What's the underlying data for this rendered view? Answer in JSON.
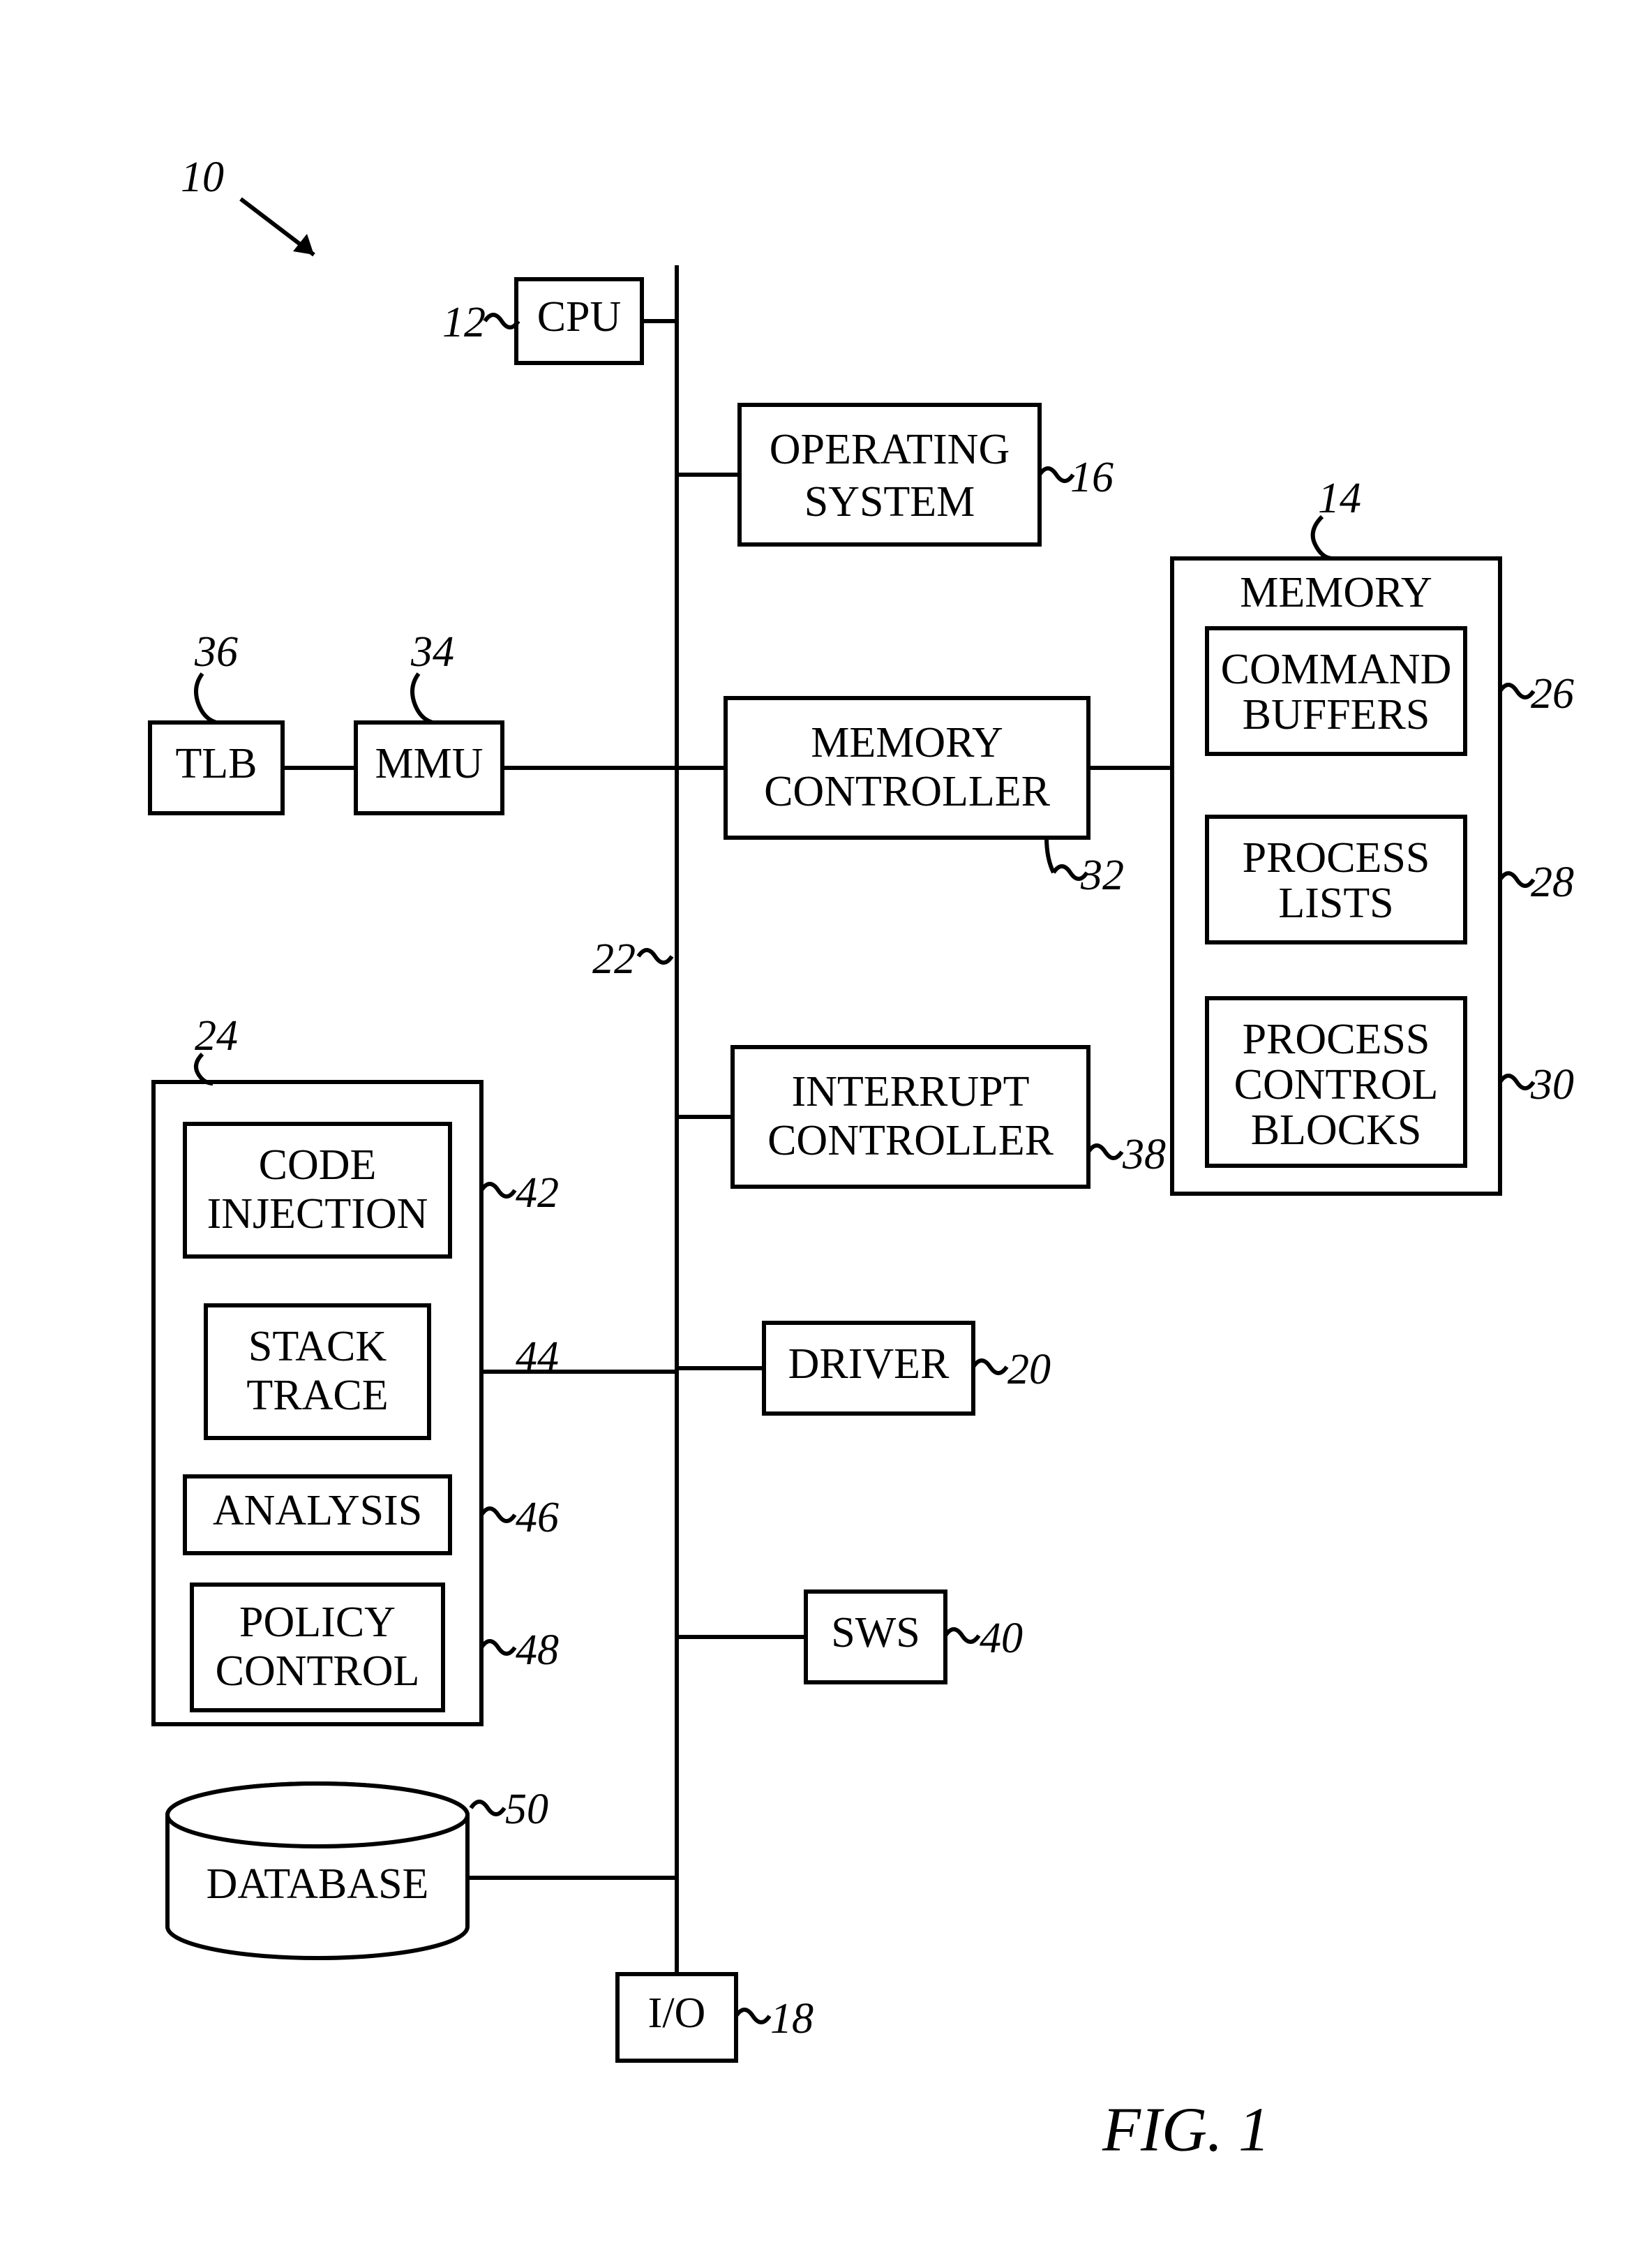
{
  "figure": {
    "caption": "FIG. 1",
    "overall_ref": "10"
  },
  "blocks": {
    "cpu": {
      "label": "CPU",
      "ref": "12"
    },
    "os": {
      "label1": "OPERATING",
      "label2": "SYSTEM",
      "ref": "16"
    },
    "mem": {
      "title": "MEMORY",
      "ref": "14"
    },
    "cmdbuf": {
      "label1": "COMMAND",
      "label2": "BUFFERS",
      "ref": "26"
    },
    "plist": {
      "label1": "PROCESS",
      "label2": "LISTS",
      "ref": "28"
    },
    "pcb": {
      "label1": "PROCESS",
      "label2": "CONTROL",
      "label3": "BLOCKS",
      "ref": "30"
    },
    "mmu": {
      "label": "MMU",
      "ref": "34"
    },
    "tlb": {
      "label": "TLB",
      "ref": "36"
    },
    "memctl": {
      "label1": "MEMORY",
      "label2": "CONTROLLER",
      "ref": "32"
    },
    "intctl": {
      "label1": "INTERRUPT",
      "label2": "CONTROLLER",
      "ref": "38"
    },
    "busref": {
      "ref": "22"
    },
    "module": {
      "ref": "24"
    },
    "codeinj": {
      "label1": "CODE",
      "label2": "INJECTION",
      "ref": "42"
    },
    "stktrace": {
      "label1": "STACK",
      "label2": "TRACE",
      "ref": "44"
    },
    "analysis": {
      "label": "ANALYSIS",
      "ref": "46"
    },
    "policy": {
      "label1": "POLICY",
      "label2": "CONTROL",
      "ref": "48"
    },
    "driver": {
      "label": "DRIVER",
      "ref": "20"
    },
    "sws": {
      "label": "SWS",
      "ref": "40"
    },
    "db": {
      "label": "DATABASE",
      "ref": "50"
    },
    "io": {
      "label": "I/O",
      "ref": "18"
    }
  }
}
